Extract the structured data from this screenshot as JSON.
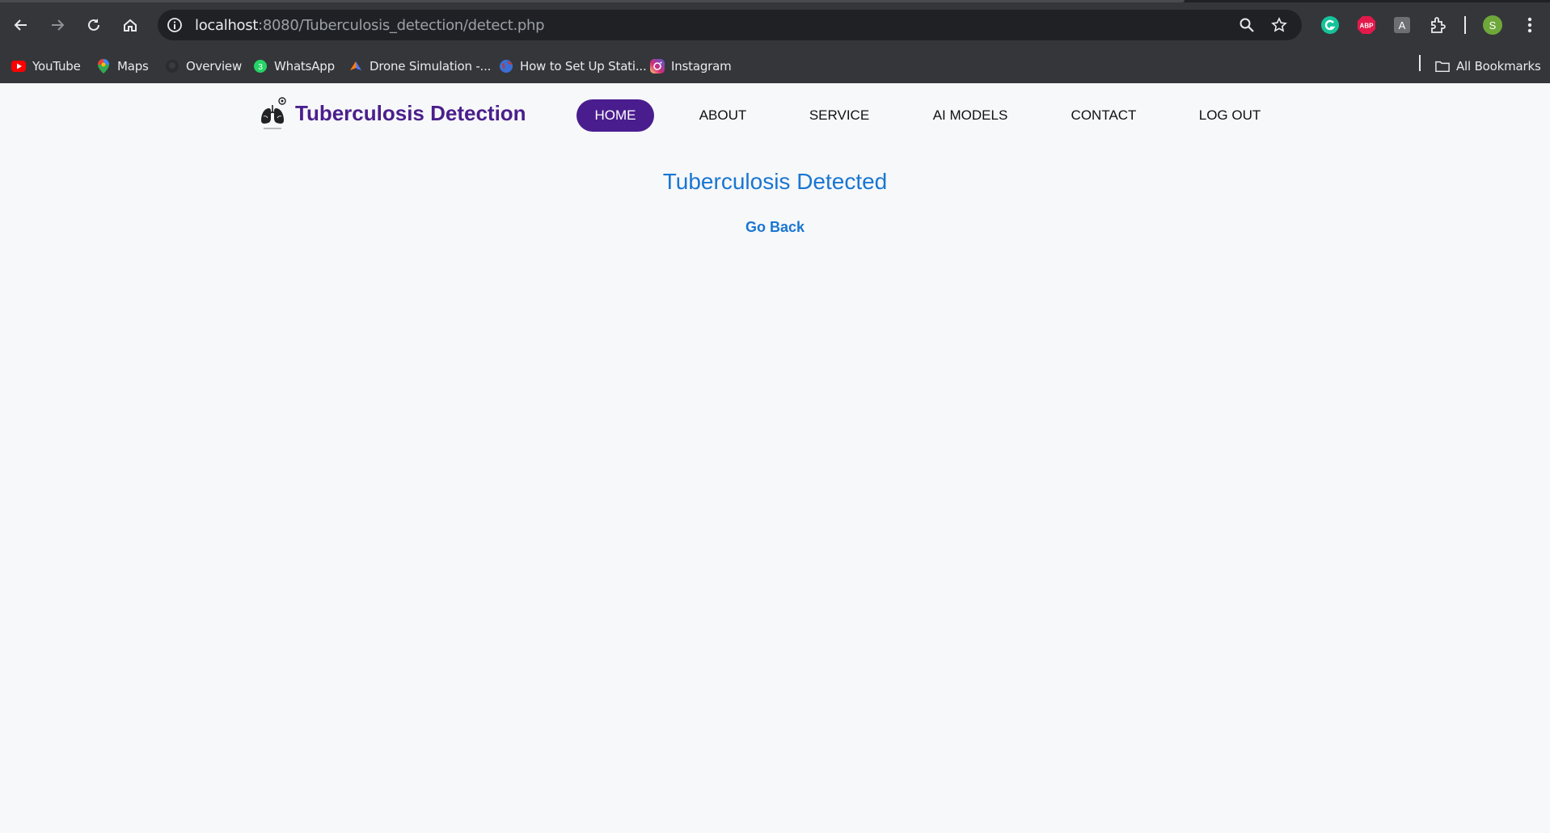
{
  "browser": {
    "url_host": "localhost",
    "url_rest": ":8080/Tuberculosis_detection/detect.php",
    "profile_initial": "S",
    "abp_label": "ABP",
    "ext_a_label": "A"
  },
  "bookmarks": {
    "items": [
      "YouTube",
      "Maps",
      "Overview",
      "WhatsApp",
      "Drone Simulation -...",
      "How to Set Up Stati...",
      "Instagram"
    ],
    "whatsapp_badge": "3",
    "all_bookmarks": "All Bookmarks"
  },
  "header": {
    "brand": "Tuberculosis Detection",
    "nav": [
      "HOME",
      "ABOUT",
      "SERVICE",
      "AI MODELS",
      "CONTACT",
      "LOG OUT"
    ]
  },
  "main": {
    "result": "Tuberculosis Detected",
    "go_back": "Go Back"
  },
  "colors": {
    "brand": "#4a1f8c",
    "nav_active": "#4a1d8f",
    "result_text": "#1976d2",
    "page_bg": "#f7f8fa"
  }
}
